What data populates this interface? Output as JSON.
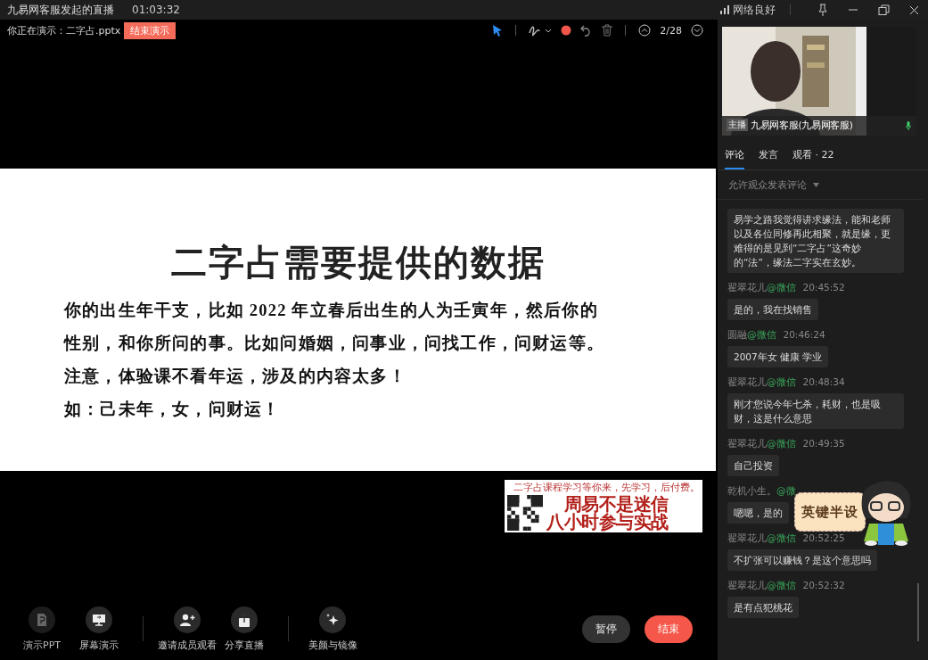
{
  "window": {
    "title": "九易网客服发起的直播",
    "elapsed": "01:03:32",
    "network": "网络良好"
  },
  "present_bar": {
    "label": "你正在演示：二字占.pptx",
    "end_button": "结束演示",
    "page": "2/28"
  },
  "tools": [
    {
      "kind": "pointer",
      "selected": true
    },
    {
      "kind": "pen",
      "selected": false
    },
    {
      "kind": "record",
      "selected": false
    },
    {
      "kind": "undo",
      "selected": false
    },
    {
      "kind": "trash",
      "selected": false
    }
  ],
  "slide": {
    "title": "二字占需要提供的数据",
    "lines": [
      "你的出生年干支，比如 2022 年立春后出生的人为壬寅年，然后你的",
      "性别，和你所问的事。比如问婚姻，问事业，问找工作，问财运等。",
      "注意，体验课不看年运，涉及的内容太多！",
      "如：己未年，女，问财运！"
    ]
  },
  "banner": {
    "small": "二字占课程学习等你来，先学习，后付费。",
    "lines": [
      "周易不是迷信",
      "八小时参与实战"
    ]
  },
  "bottom_tools": [
    {
      "kind": "ppt",
      "label": "演示PPT",
      "disabled": true
    },
    {
      "kind": "screen",
      "label": "屏幕演示",
      "disabled": false
    },
    {
      "kind": "invite",
      "label": "邀请成员观看",
      "disabled": false
    },
    {
      "kind": "share",
      "label": "分享直播",
      "disabled": false
    },
    {
      "kind": "beauty",
      "label": "美颜与镜像",
      "disabled": false
    }
  ],
  "actions": {
    "pause": "暂停",
    "end": "结束"
  },
  "host": {
    "badge": "主播",
    "name": "九易网客服(九易网客服)"
  },
  "tabs": [
    {
      "label": "评论",
      "selected": true
    },
    {
      "label": "发言",
      "selected": false
    },
    {
      "label": "观看 · 22",
      "selected": false
    }
  ],
  "filter": {
    "label": "允许观众发表评论"
  },
  "messages": [
    {
      "text": "易学之路我觉得讲求缘法，能和老师以及各位同修再此相聚，就是缘，更难得的是见到“二字占”这奇妙的“法”，缘法二字实在玄妙。"
    },
    {
      "name": "翟翠花儿",
      "source": "@微信",
      "time": "20:45:52",
      "text": "是的，我在找销售"
    },
    {
      "name": "圆融",
      "source": "@微信",
      "time": "20:46:24",
      "text": "2007年女 健康 学业"
    },
    {
      "name": "翟翠花儿",
      "source": "@微信",
      "time": "20:48:34",
      "text": "刚才您说今年七杀，耗财，也是吸财，这是什么意思"
    },
    {
      "name": "翟翠花儿",
      "source": "@微信",
      "time": "20:49:35",
      "text": "自己投资"
    },
    {
      "name": "乾机小生。",
      "source": "@微",
      "text": "嗯嗯，是的"
    },
    {
      "name": "翟翠花儿",
      "source": "@微信",
      "time": "20:52:25",
      "text": "不扩张可以赚钱？是这个意思吗"
    },
    {
      "name": "翟翠花儿",
      "source": "@微信",
      "time": "20:52:32",
      "text": "是有点犯桃花"
    }
  ],
  "sticker": {
    "text": "英键半设"
  }
}
